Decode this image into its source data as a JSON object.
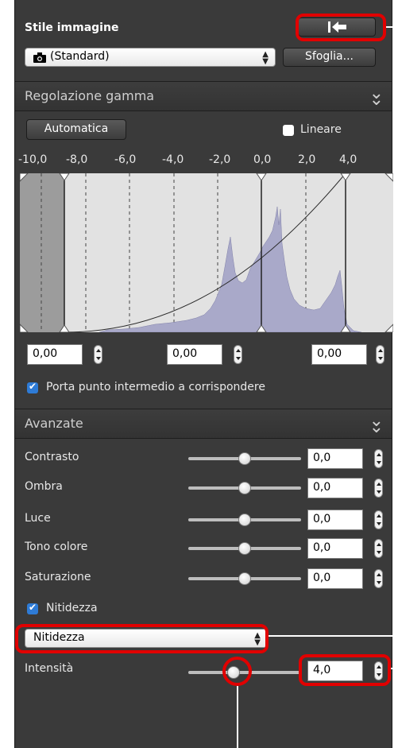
{
  "picture_style": {
    "label": "Stile immagine",
    "dropdown_value": "(Standard)",
    "browse_button": "Sfoglia..."
  },
  "tone_curve": {
    "title": "Regolazione gamma",
    "auto_button": "Automatica",
    "linear_label": "Lineare",
    "linear_checked": false,
    "ticks": [
      "-10,0",
      "-8,0",
      "-6,0",
      "-4,0",
      "-2,0",
      "0,0",
      "2,0",
      "4,0"
    ],
    "black_point": "0,00",
    "midpoint": "0,00",
    "white_point": "0,00",
    "link_midpoint_label": "Porta punto intermedio a corrispondere",
    "link_midpoint_checked": true
  },
  "advanced": {
    "title": "Avanzate",
    "sliders": [
      {
        "label": "Contrasto",
        "value": "0,0",
        "position": 0.5
      },
      {
        "label": "Ombra",
        "value": "0,0",
        "position": 0.5
      },
      {
        "label": "Luce",
        "value": "0,0",
        "position": 0.5
      },
      {
        "label": "Tono colore",
        "value": "0,0",
        "position": 0.5
      },
      {
        "label": "Saturazione",
        "value": "0,0",
        "position": 0.5
      }
    ],
    "sharpness_label": "Nitidezza",
    "sharpness_checked": true,
    "sharpness_mode": "Nitidezza",
    "strength_label": "Intensità",
    "strength_value": "4,0",
    "strength_position": 0.4
  },
  "colors": {
    "panel": "#3a3a3a",
    "highlight": "#e10000",
    "histogram": "#a9a9c9"
  },
  "icons": [
    "camera-icon",
    "reset-icon",
    "chevron-double-down-icon",
    "stepper-icon",
    "checkbox-icon"
  ]
}
